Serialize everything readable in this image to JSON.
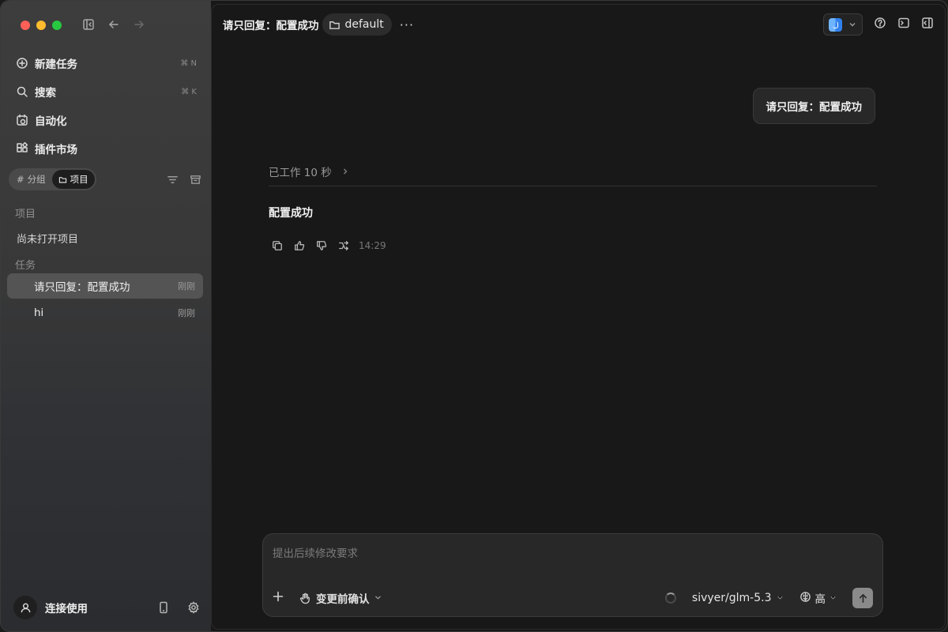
{
  "window": {
    "title": "请只回复：配置成功"
  },
  "sidebar": {
    "nav": [
      {
        "label": "新建任务",
        "shortcut": "⌘ N",
        "icon": "new-task-icon"
      },
      {
        "label": "搜索",
        "shortcut": "⌘ K",
        "icon": "search-icon"
      },
      {
        "label": "自动化",
        "shortcut": "",
        "icon": "automation-clock-icon"
      },
      {
        "label": "插件市场",
        "shortcut": "",
        "icon": "plugin-market-icon"
      }
    ],
    "segment": {
      "group_label": "分组",
      "project_label": "项目",
      "active": "项目"
    },
    "projects_header": "项目",
    "no_project": "尚未打开项目",
    "tasks_header": "任务",
    "tasks": [
      {
        "name": "请只回复：配置成功",
        "time": "刚刚",
        "selected": true
      },
      {
        "name": "hi",
        "time": "刚刚",
        "selected": false
      }
    ],
    "footer": {
      "user_label": "连接使用"
    }
  },
  "main": {
    "header": {
      "title": "请只回复：配置成功",
      "folder": "default",
      "more": "···"
    },
    "user_message": "请只回复：配置成功",
    "worked": "已工作 10 秒",
    "reply": "配置成功",
    "reply_time": "14:29",
    "composer": {
      "placeholder": "提出后续修改要求",
      "confirm_label": "变更前确认",
      "model": "sivyer/glm-5.3",
      "effort": "高"
    }
  },
  "colors": {
    "sidebar_bg": "#3d3d3d",
    "main_bg": "#181818",
    "selected_task": "#545454",
    "accent_send": "#8a8a8a"
  }
}
